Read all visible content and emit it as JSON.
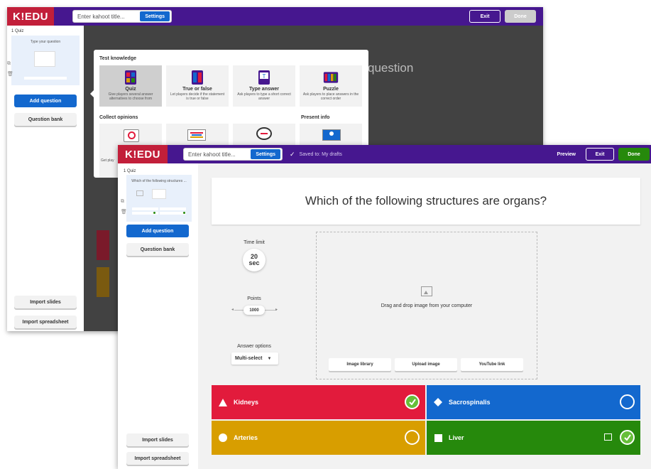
{
  "back": {
    "logo": "K!EDU",
    "title_placeholder": "Enter kahoot title...",
    "settings": "Settings",
    "exit": "Exit",
    "done": "Done",
    "slide_label": "1 Quiz",
    "slide_preview": "Type your question",
    "add_question": "Add question",
    "question_bank": "Question bank",
    "import_slides": "Import slides",
    "import_spreadsheet": "Import spreadsheet",
    "behind_text": "question",
    "popup": {
      "test_knowledge": "Test knowledge",
      "collect_opinions": "Collect opinions",
      "present_info": "Present info",
      "tiles": [
        {
          "title": "Quiz",
          "desc": "Give players several answer alternatives to choose from"
        },
        {
          "title": "True or false",
          "desc": "Let players decide if the statement is true or false"
        },
        {
          "title": "Type answer",
          "desc": "Ask players to type a short correct answer"
        },
        {
          "title": "Puzzle",
          "desc": "Ask players to place answers in the correct order"
        }
      ],
      "partial_text": "Get play"
    }
  },
  "front": {
    "logo": "K!EDU",
    "title_placeholder": "Enter kahoot title...",
    "settings": "Settings",
    "saved": "Saved to: My drafts",
    "preview": "Preview",
    "exit": "Exit",
    "done": "Done",
    "slide_label": "1 Quiz",
    "slide_preview": "Which of the following structures ...",
    "add_question": "Add question",
    "question_bank": "Question bank",
    "import_slides": "Import slides",
    "import_spreadsheet": "Import spreadsheet",
    "question": "Which of the following structures are organs?",
    "time_limit_label": "Time limit",
    "time_limit_value": "20",
    "time_limit_unit": "sec",
    "points_label": "Points",
    "points_value": "1000",
    "answer_options_label": "Answer options",
    "answer_options_value": "Multi-select",
    "drop_text": "Drag and drop image from your computer",
    "image_library": "Image library",
    "upload_image": "Upload image",
    "youtube_link": "YouTube link",
    "answers": [
      {
        "text": "Kidneys",
        "color": "#e21b3c",
        "correct": true
      },
      {
        "text": "Sacrospinalis",
        "color": "#1368ce",
        "correct": false
      },
      {
        "text": "Arteries",
        "color": "#d89e00",
        "correct": false
      },
      {
        "text": "Liver",
        "color": "#26890c",
        "correct": true
      }
    ]
  }
}
